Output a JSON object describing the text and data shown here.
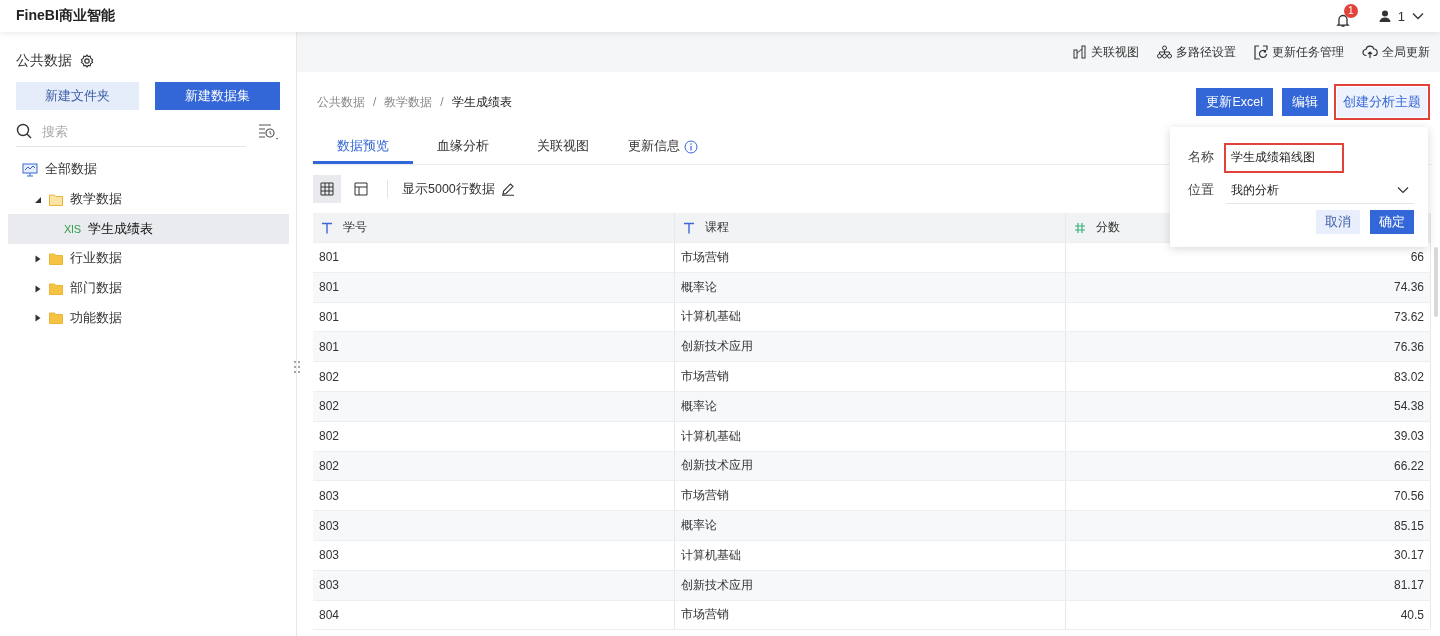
{
  "app": {
    "title": "FineBI商业智能",
    "notifications": "1",
    "user": "1"
  },
  "sidebar": {
    "title": "公共数据",
    "buttons": [
      {
        "label": "新建文件夹",
        "kind": "secondary"
      },
      {
        "label": "新建数据集",
        "kind": "primary"
      }
    ],
    "search": {
      "placeholder": "搜索"
    },
    "tree": [
      {
        "label": "全部数据",
        "kind": "root",
        "selected": false,
        "children": [
          {
            "label": "教学数据",
            "kind": "folder",
            "expanded": true,
            "selected": false,
            "children": [
              {
                "label": "学生成绩表",
                "kind": "file",
                "badge": "XlS",
                "selected": true
              }
            ]
          },
          {
            "label": "行业数据",
            "kind": "folder",
            "expanded": false,
            "selected": false
          },
          {
            "label": "部门数据",
            "kind": "folder",
            "expanded": false,
            "selected": false
          },
          {
            "label": "功能数据",
            "kind": "folder",
            "expanded": false,
            "selected": false
          }
        ]
      }
    ]
  },
  "toolbar": [
    {
      "label": "关联视图",
      "kind": "relation"
    },
    {
      "label": "多路径设置",
      "kind": "paths"
    },
    {
      "label": "更新任务管理",
      "kind": "tasks"
    },
    {
      "label": "全局更新",
      "kind": "cloud"
    }
  ],
  "breadcrumb": [
    {
      "label": "公共数据",
      "kind": "link",
      "current": false
    },
    {
      "label": "/",
      "kind": "separator"
    },
    {
      "label": "教学数据",
      "kind": "link",
      "current": false
    },
    {
      "label": "/",
      "kind": "separator"
    },
    {
      "label": "学生成绩表",
      "kind": "link",
      "current": true
    }
  ],
  "actions": [
    {
      "label": "更新Excel",
      "kind": "primary",
      "highlighted": false
    },
    {
      "label": "编辑",
      "kind": "primary",
      "highlighted": false
    },
    {
      "label": "创建分析主题",
      "kind": "link",
      "highlighted": true
    }
  ],
  "tabs": [
    {
      "label": "数据预览",
      "selected": true,
      "info": false
    },
    {
      "label": "血缘分析",
      "selected": false,
      "info": false
    },
    {
      "label": "关联视图",
      "selected": false,
      "info": false
    },
    {
      "label": "更新信息",
      "selected": false,
      "info": true
    }
  ],
  "view_modes": [
    {
      "kind": "grid",
      "selected": true
    },
    {
      "kind": "layout",
      "selected": false
    }
  ],
  "row_limit": "显示5000行数据",
  "table": {
    "columns": [
      {
        "label": "学号",
        "kind": "text"
      },
      {
        "label": "课程",
        "kind": "text"
      },
      {
        "label": "分数",
        "kind": "number"
      }
    ],
    "rows": [
      [
        "801",
        "市场营销",
        "66"
      ],
      [
        "801",
        "概率论",
        "74.36"
      ],
      [
        "801",
        "计算机基础",
        "73.62"
      ],
      [
        "801",
        "创新技术应用",
        "76.36"
      ],
      [
        "802",
        "市场营销",
        "83.02"
      ],
      [
        "802",
        "概率论",
        "54.38"
      ],
      [
        "802",
        "计算机基础",
        "39.03"
      ],
      [
        "802",
        "创新技术应用",
        "66.22"
      ],
      [
        "803",
        "市场营销",
        "70.56"
      ],
      [
        "803",
        "概率论",
        "85.15"
      ],
      [
        "803",
        "计算机基础",
        "30.17"
      ],
      [
        "803",
        "创新技术应用",
        "81.17"
      ],
      [
        "804",
        "市场营销",
        "40.5"
      ]
    ]
  },
  "popover": {
    "fields": [
      {
        "label": "名称",
        "kind": "input",
        "value": "学生成绩箱线图",
        "highlighted": true
      },
      {
        "label": "位置",
        "kind": "select",
        "value": "我的分析",
        "highlighted": false
      }
    ],
    "buttons": [
      {
        "label": "取消",
        "kind": "secondary"
      },
      {
        "label": "确定",
        "kind": "primary"
      }
    ]
  }
}
